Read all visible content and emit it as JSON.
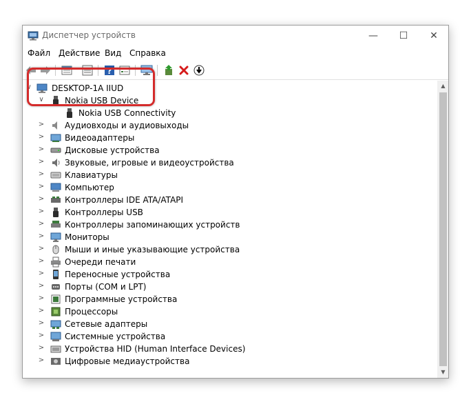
{
  "window": {
    "title": "Диспетчер устройств",
    "controls": {
      "minimize": "—",
      "maximize": "☐",
      "close": "✕"
    }
  },
  "menu": [
    "Файл",
    "Действие",
    "Вид",
    "Справка"
  ],
  "toolbar": {
    "buttons": [
      "back-icon",
      "forward-icon",
      "properties-icon",
      "show-hide-icon",
      "help-icon",
      "action-list-icon",
      "monitor-icon",
      "update-driver-icon",
      "uninstall-icon",
      "download-icon"
    ]
  },
  "tree": {
    "root": "DESKTOP-1A IIUD",
    "expanded_group": {
      "label": "Nokia USB Device",
      "children": [
        "Nokia USB Connectivity"
      ]
    },
    "groups": [
      {
        "label": "Аудиовходы и аудиовыходы",
        "icon": "speaker-icon"
      },
      {
        "label": "Видеоадаптеры",
        "icon": "display-adapter-icon"
      },
      {
        "label": "Дисковые устройства",
        "icon": "disk-drive-icon"
      },
      {
        "label": "Звуковые, игровые и видеоустройства",
        "icon": "sound-icon"
      },
      {
        "label": "Клавиатуры",
        "icon": "keyboard-icon"
      },
      {
        "label": "Компьютер",
        "icon": "computer-icon"
      },
      {
        "label": "Контроллеры IDE ATA/ATAPI",
        "icon": "ide-controller-icon"
      },
      {
        "label": "Контроллеры USB",
        "icon": "usb-icon"
      },
      {
        "label": "Контроллеры запоминающих устройств",
        "icon": "storage-controller-icon"
      },
      {
        "label": "Мониторы",
        "icon": "monitor-icon"
      },
      {
        "label": "Мыши и иные указывающие устройства",
        "icon": "mouse-icon"
      },
      {
        "label": "Очереди печати",
        "icon": "printer-icon"
      },
      {
        "label": "Переносные устройства",
        "icon": "portable-device-icon"
      },
      {
        "label": "Порты (COM и LPT)",
        "icon": "port-icon"
      },
      {
        "label": "Программные устройства",
        "icon": "software-device-icon"
      },
      {
        "label": "Процессоры",
        "icon": "processor-icon"
      },
      {
        "label": "Сетевые адаптеры",
        "icon": "network-adapter-icon"
      },
      {
        "label": "Системные устройства",
        "icon": "system-device-icon"
      },
      {
        "label": "Устройства HID (Human Interface Devices)",
        "icon": "hid-icon"
      },
      {
        "label": "Цифровые медиаустройства",
        "icon": "media-device-icon"
      }
    ]
  },
  "scrollbar": {
    "up": "▲",
    "down": "▼"
  },
  "tree_glyphs": {
    "expanded": "∨",
    "collapsed": ">"
  },
  "colors": {
    "highlight": "#d42b2b"
  }
}
